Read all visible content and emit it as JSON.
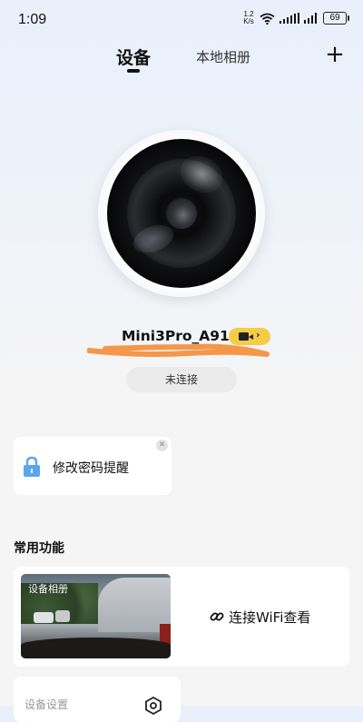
{
  "status_bar": {
    "time": "1:09",
    "net_speed_value": "1.2",
    "net_speed_unit": "K/s",
    "battery": "69"
  },
  "tabs": {
    "device": "设备",
    "local_album": "本地相册",
    "add": "+"
  },
  "device": {
    "name": "Mini3Pro_A91E",
    "type_icon": "video-camera-icon",
    "status": "未连接"
  },
  "password_card": {
    "label": "修改密码提醒",
    "icon": "lock-icon"
  },
  "features": {
    "section_title": "常用功能",
    "album_label": "设备相册",
    "connect_wifi": "连接WiFi查看",
    "settings_label": "设备设置"
  },
  "colors": {
    "chip": "#f4cd45",
    "lock": "#5aa6ea",
    "scribble": "#f5974a"
  }
}
